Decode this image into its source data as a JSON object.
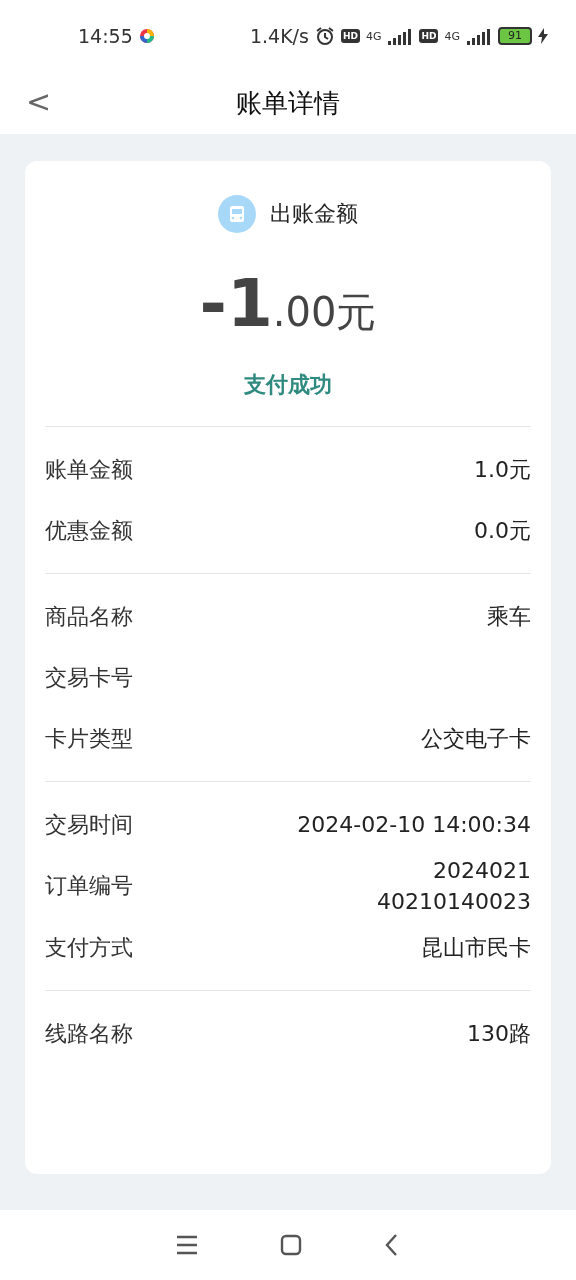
{
  "status_bar": {
    "time": "14:55",
    "speed": "1.4K/s",
    "hd_1": "HD",
    "network_1": "4G",
    "hd_2": "HD",
    "network_2": "4G",
    "battery": "91"
  },
  "header": {
    "back": "<",
    "title": "账单详情"
  },
  "summary": {
    "label": "出账金额",
    "amount_main": "-1",
    "amount_fraction": ".00元",
    "status": "支付成功"
  },
  "sections": [
    [
      {
        "label": "账单金额",
        "value": [
          "1.0元"
        ]
      },
      {
        "label": "优惠金额",
        "value": [
          "0.0元"
        ]
      }
    ],
    [
      {
        "label": "商品名称",
        "value": [
          "乘车"
        ]
      },
      {
        "label": "交易卡号"
      },
      {
        "label": "卡片类型",
        "value": [
          "公交电子卡"
        ]
      }
    ],
    [
      {
        "label": "交易时间",
        "value": [
          "2024-02-10 14:00:34"
        ]
      },
      {
        "label": "订单编号",
        "value": [
          "2024021",
          "40210140023"
        ]
      },
      {
        "label": "支付方式",
        "value": [
          "昆山市民卡"
        ]
      }
    ],
    [
      {
        "label": "线路名称",
        "value": [
          "130路"
        ]
      }
    ]
  ]
}
